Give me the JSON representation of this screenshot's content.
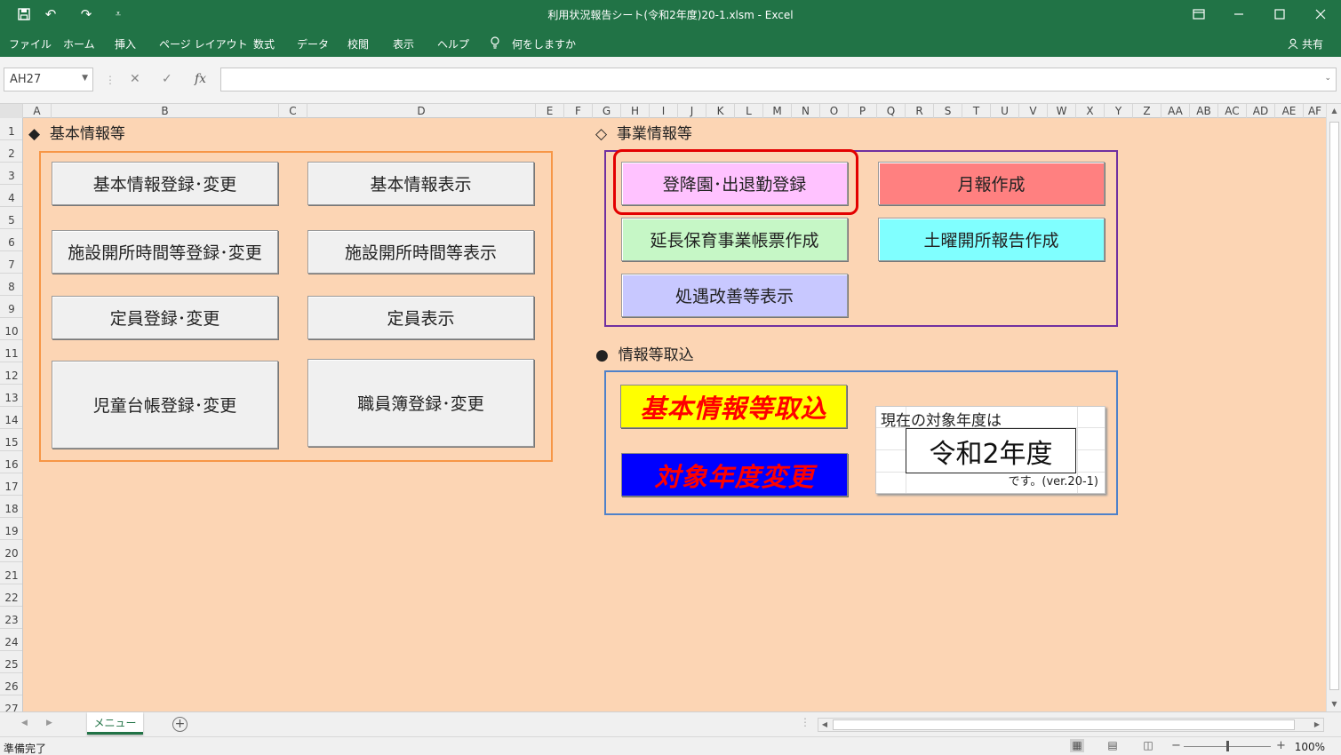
{
  "window": {
    "title": "利用状況報告シート(令和2年度)20-1.xlsm  -  Excel",
    "quick_access": [
      "save-icon",
      "undo-icon",
      "redo-icon",
      "customize-icon"
    ],
    "controls": [
      "ribbon-display-icon",
      "minimize-icon",
      "maximize-icon",
      "close-icon"
    ]
  },
  "ribbon": {
    "tabs": [
      "ファイル",
      "ホーム",
      "挿入",
      "ページ レイアウト",
      "数式",
      "データ",
      "校閲",
      "表示",
      "ヘルプ",
      "何をしますか"
    ],
    "share": "共有"
  },
  "formula_bar": {
    "name_box": "AH27",
    "formula": ""
  },
  "grid": {
    "columns": [
      "A",
      "B",
      "C",
      "D",
      "E",
      "F",
      "G",
      "H",
      "I",
      "J",
      "K",
      "L",
      "M",
      "N",
      "O",
      "P",
      "Q",
      "R",
      "S",
      "T",
      "U",
      "V",
      "W",
      "X",
      "Y",
      "Z",
      "AA",
      "AB",
      "AC",
      "AD",
      "AE",
      "AF"
    ],
    "rows": [
      "1",
      "2",
      "3",
      "4",
      "5",
      "6",
      "7",
      "8",
      "9",
      "10",
      "11",
      "12",
      "13",
      "14",
      "15",
      "16",
      "17",
      "18",
      "19",
      "20",
      "21",
      "22",
      "23",
      "24",
      "25",
      "26",
      "27"
    ]
  },
  "sheet": {
    "basic_section": {
      "marker": "◆",
      "title": "基本情報等",
      "buttons": {
        "basic_register": "基本情報登録･変更",
        "basic_display": "基本情報表示",
        "hours_register": "施設開所時間等登録･変更",
        "hours_display": "施設開所時間等表示",
        "capacity_register": "定員登録･変更",
        "capacity_display": "定員表示",
        "children_register": "児童台帳登録･変更",
        "staff_register": "職員簿登録･変更"
      }
    },
    "business_section": {
      "marker": "◇",
      "title": "事業情報等",
      "buttons": {
        "attendance": "登降園･出退勤登録",
        "monthly_report": "月報作成",
        "extended_care": "延長保育事業帳票作成",
        "saturday_report": "土曜開所報告作成",
        "treatment_display": "処遇改善等表示"
      },
      "colors": {
        "attendance": "#ffc2ff",
        "monthly_report": "#ff8080",
        "extended_care": "#c6f7c6",
        "saturday_report": "#80ffff",
        "treatment_display": "#c8c8ff",
        "frame": "#7030a0",
        "highlight": "#e30000"
      }
    },
    "import_section": {
      "marker": "●",
      "title": "情報等取込",
      "buttons": {
        "import_basic": "基本情報等取込",
        "change_year": "対象年度変更"
      },
      "colors": {
        "import_basic": "#ffff00",
        "change_year": "#0000ff",
        "text": "#ff0000",
        "frame": "#4f81c9"
      },
      "year_box": {
        "label": "現在の対象年度は",
        "value": "令和2年度",
        "suffix": "です。(ver.20-1)"
      }
    },
    "background": "#fcd5b4",
    "basic_frame_color": "#f79646"
  },
  "sheet_tabs": {
    "active": "メニュー"
  },
  "status_bar": {
    "ready": "準備完了",
    "zoom": "100%"
  }
}
